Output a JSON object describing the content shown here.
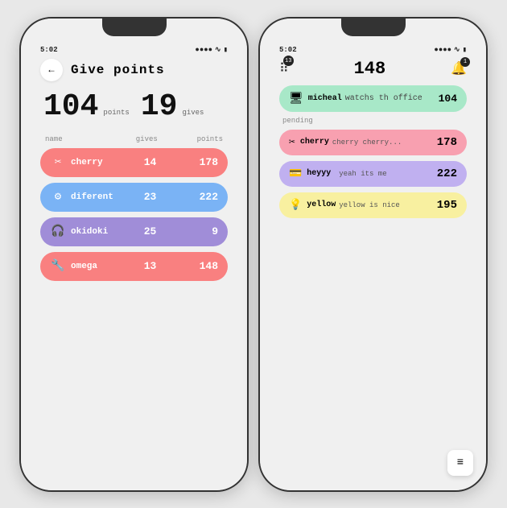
{
  "phone1": {
    "status": {
      "time": "5:02",
      "signal": "●●●",
      "wifi": "WiFi",
      "battery": "🔋"
    },
    "header": {
      "back_label": "←",
      "title": "Give points"
    },
    "stats": {
      "points_value": "104",
      "points_label": "points",
      "gives_value": "19",
      "gives_label": "gives"
    },
    "table": {
      "col_name": "name",
      "col_gives": "gives",
      "col_points": "points"
    },
    "items": [
      {
        "icon": "✂",
        "name": "cherry",
        "gives": "14",
        "points": "178",
        "color": "coral"
      },
      {
        "icon": "⚙",
        "name": "diferent",
        "gives": "23",
        "points": "222",
        "color": "blue"
      },
      {
        "icon": "🎧",
        "name": "okidoki",
        "gives": "25",
        "points": "9",
        "color": "lavender"
      },
      {
        "icon": "🔧",
        "name": "omega",
        "gives": "13",
        "points": "148",
        "color": "salmon"
      }
    ]
  },
  "phone2": {
    "status": {
      "time": "5:02",
      "signal": "●●●●",
      "wifi": "WiFi",
      "battery": "🔋"
    },
    "header": {
      "dots_badge": "13",
      "total_points": "148",
      "bell_badge": "1"
    },
    "top_card": {
      "icon": "🖥",
      "user": "micheal",
      "description": "watchs th office",
      "points": "104"
    },
    "pending_label": "pending",
    "items": [
      {
        "icon": "✂",
        "name": "cherry",
        "description": "cherry cherry...",
        "points": "178",
        "color": "pink"
      },
      {
        "icon": "💳",
        "name": "heyyy",
        "description": "yeah its me",
        "points": "222",
        "color": "purple"
      },
      {
        "icon": "💡",
        "name": "yellow",
        "description": "yellow is nice",
        "points": "195",
        "color": "yellow"
      }
    ],
    "fab_icon": "≡"
  }
}
